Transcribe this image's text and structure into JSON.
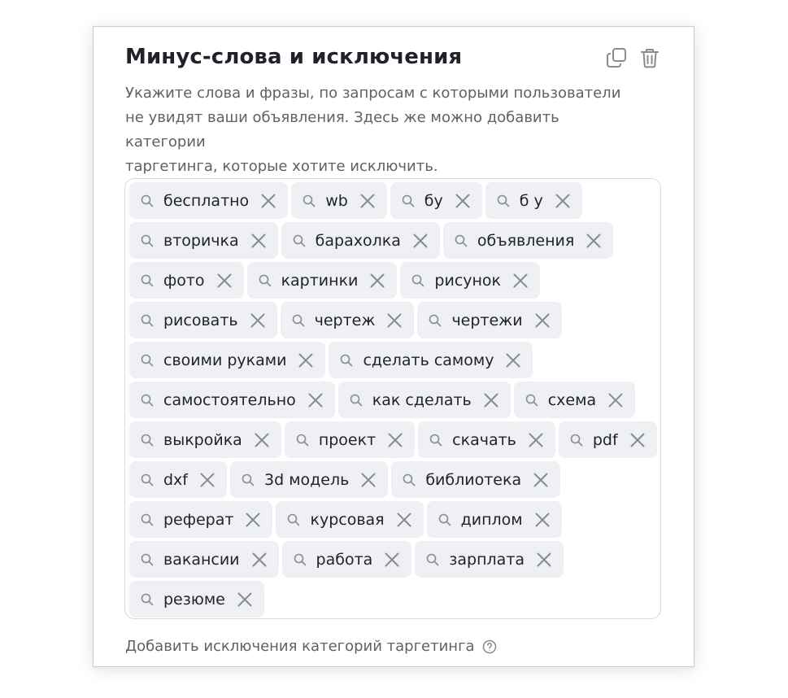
{
  "panel": {
    "title": "Минус-слова и исключения",
    "description_lines": [
      "Укажите слова и фразы, по запросам с которыми пользователи",
      "не увидят ваши объявления. Здесь же можно добавить категории",
      "таргетинга, которые хотите исключить."
    ],
    "actions": [
      "copy-icon",
      "trash-icon"
    ],
    "tag_rows": [
      [
        "бесплатно",
        "wb",
        "бу",
        "б у"
      ],
      [
        "вторичка",
        "барахолка",
        "объявления"
      ],
      [
        "фото",
        "картинки",
        "рисунок"
      ],
      [
        "рисовать",
        "чертеж",
        "чертежи"
      ],
      [
        "своими руками",
        "сделать самому"
      ],
      [
        "самостоятельно",
        "как сделать",
        "схема"
      ],
      [
        "выкройка",
        "проект",
        "скачать",
        "pdf"
      ],
      [
        "dxf",
        "3d модель",
        "библиотека"
      ],
      [
        "реферат",
        "курсовая",
        "диплом"
      ],
      [
        "вакансии",
        "работа",
        "зарплата"
      ],
      [
        "резюме"
      ]
    ],
    "footer_link": "Добавить исключения категорий таргетинга"
  },
  "colors": {
    "title": "#1f2329",
    "muted_text": "#5d6269",
    "tag_background": "#eef0f3",
    "icon": "#878c94",
    "border": "#d8dade"
  }
}
